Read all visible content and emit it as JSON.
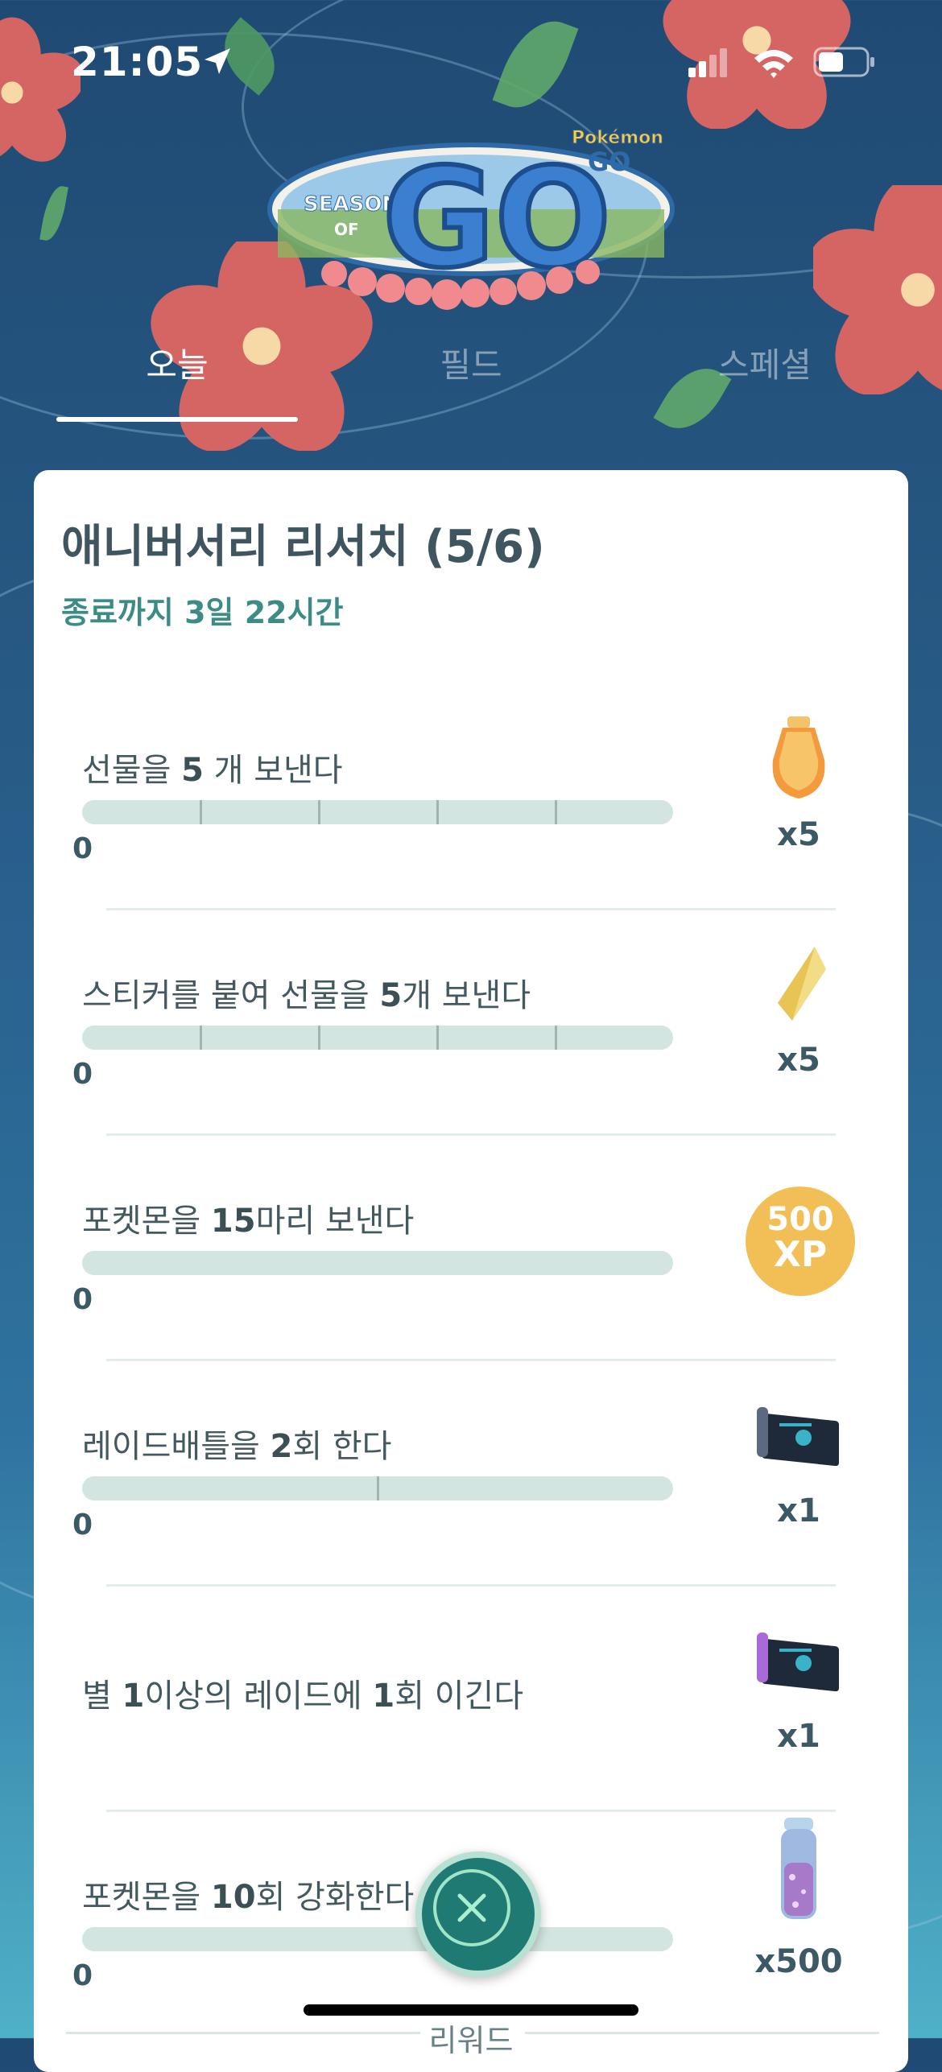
{
  "status_bar": {
    "time": "21:05"
  },
  "logo": {
    "season_text": "SEASON",
    "of_text": "OF",
    "go_text": "GO",
    "brand_text": "Pokémon",
    "brand_go": "GO"
  },
  "tabs": [
    {
      "label": "오늘",
      "active": true
    },
    {
      "label": "필드",
      "active": false
    },
    {
      "label": "스페셜",
      "active": false
    }
  ],
  "research": {
    "title": "애니버서리 리서치 (5/6)",
    "subtitle": "종료까지 3일 22시간",
    "tasks": [
      {
        "pre": "선물을 ",
        "num": "5",
        "post": " 개 보낸다",
        "progress": "0",
        "goal": 5,
        "reward_icon": "incense-icon",
        "reward_count": "x5"
      },
      {
        "pre": "스티커를 붙여 선물을 ",
        "num": "5",
        "post": "개 보낸다",
        "progress": "0",
        "goal": 5,
        "reward_icon": "star-piece-icon",
        "reward_count": "x5"
      },
      {
        "pre": "포켓몬을 ",
        "num": "15",
        "post": "마리 보낸다",
        "progress": "0",
        "goal": 15,
        "reward_icon": "xp-badge",
        "reward_xp_num": "500",
        "reward_xp_label": "XP"
      },
      {
        "pre": "레이드배틀을 ",
        "num": "2",
        "post": "회 한다",
        "progress": "0",
        "goal": 2,
        "reward_icon": "remote-raid-pass-icon",
        "reward_count": "x1"
      },
      {
        "pre": "별 ",
        "num": "1",
        "post": "이상의 레이드에 ",
        "num2": "1",
        "post2": "회 이긴다",
        "reward_icon": "premium-raid-pass-icon",
        "reward_count": "x1"
      },
      {
        "pre": "포켓몬을 ",
        "num": "10",
        "post": "회 강화한다",
        "progress": "0",
        "goal": 10,
        "reward_icon": "stardust-icon",
        "reward_count": "x500"
      }
    ],
    "bottom_label": "리워드"
  },
  "colors": {
    "accent_teal": "#3d8b85",
    "xp_gold": "#f2bf56",
    "bar_track": "#d3e5e0"
  }
}
